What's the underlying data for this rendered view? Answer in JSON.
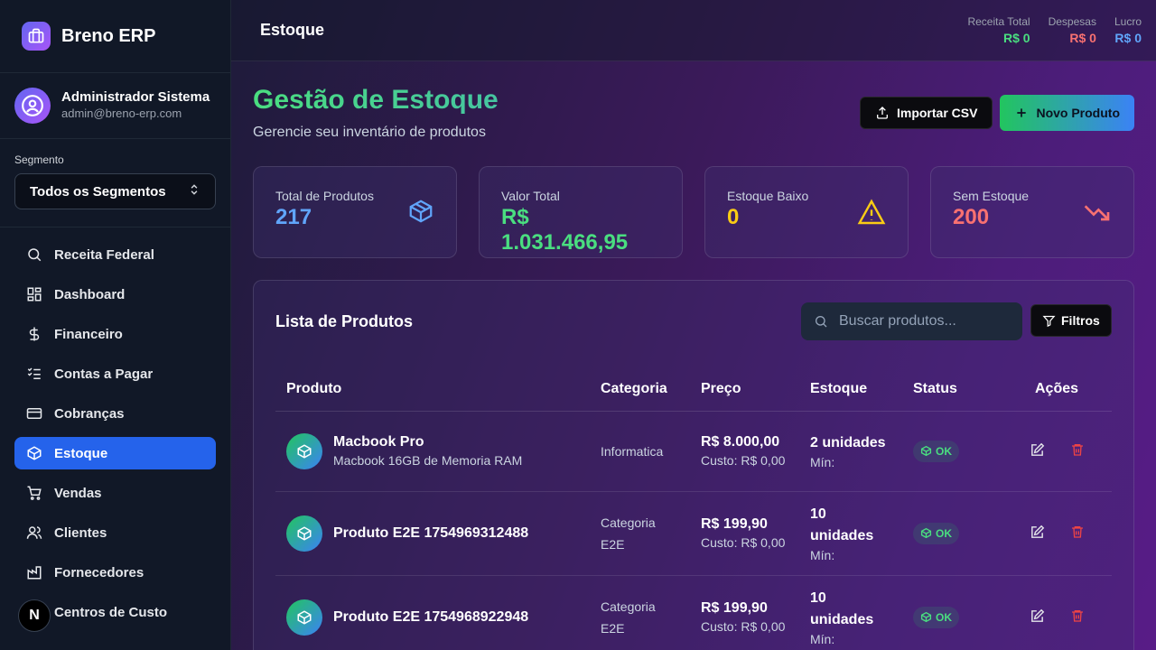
{
  "app": {
    "name": "Breno ERP"
  },
  "user": {
    "name": "Administrador Sistema",
    "email": "admin@breno-erp.com"
  },
  "segment": {
    "label": "Segmento",
    "selected": "Todos os Segmentos"
  },
  "nav": [
    {
      "label": "Receita Federal",
      "icon": "search-icon"
    },
    {
      "label": "Dashboard",
      "icon": "dashboard-icon"
    },
    {
      "label": "Financeiro",
      "icon": "dollar-icon"
    },
    {
      "label": "Contas a Pagar",
      "icon": "checklist-icon"
    },
    {
      "label": "Cobranças",
      "icon": "credit-card-icon"
    },
    {
      "label": "Estoque",
      "icon": "package-icon",
      "active": true
    },
    {
      "label": "Vendas",
      "icon": "cart-icon"
    },
    {
      "label": "Clientes",
      "icon": "users-icon"
    },
    {
      "label": "Fornecedores",
      "icon": "factory-icon"
    },
    {
      "label": "Centros de Custo",
      "icon": "next-icon"
    }
  ],
  "next_badge": "N",
  "topbar": {
    "title": "Estoque",
    "kpis": [
      {
        "label": "Receita Total",
        "value": "R$ 0",
        "color": "#4ade80"
      },
      {
        "label": "Despesas",
        "value": "R$ 0",
        "color": "#f87171"
      },
      {
        "label": "Lucro",
        "value": "R$ 0",
        "color": "#60a5fa"
      }
    ]
  },
  "page": {
    "title": "Gestão de Estoque",
    "subtitle": "Gerencie seu inventário de produtos",
    "import_label": "Importar CSV",
    "new_label": "Novo Produto"
  },
  "stats": [
    {
      "label": "Total de Produtos",
      "value": "217",
      "color": "#60a5fa",
      "icon": "package-icon"
    },
    {
      "label": "Valor Total",
      "value": "R$ 1.031.466,95",
      "color": "#4ade80",
      "icon": ""
    },
    {
      "label": "Estoque Baixo",
      "value": "0",
      "color": "#facc15",
      "icon": "warning-icon"
    },
    {
      "label": "Sem Estoque",
      "value": "200",
      "color": "#f87171",
      "icon": "trending-down-icon"
    }
  ],
  "products": {
    "title": "Lista de Produtos",
    "search_placeholder": "Buscar produtos...",
    "filter_label": "Filtros",
    "columns": [
      "Produto",
      "Categoria",
      "Preço",
      "Estoque",
      "Status",
      "Ações"
    ],
    "rows": [
      {
        "name": "Macbook Pro",
        "desc": "Macbook 16GB de Memoria RAM",
        "category": "Informatica",
        "price": "R$ 8.000,00",
        "cost": "Custo: R$ 0,00",
        "stock": "2 unidades",
        "min": "Mín:",
        "status": "OK"
      },
      {
        "name": "Produto E2E 1754969312488",
        "desc": "",
        "category": "Categoria E2E",
        "price": "R$ 199,90",
        "cost": "Custo: R$ 0,00",
        "stock": "10 unidades",
        "min": "Mín:",
        "status": "OK"
      },
      {
        "name": "Produto E2E 1754968922948",
        "desc": "",
        "category": "Categoria E2E",
        "price": "R$ 199,90",
        "cost": "Custo: R$ 0,00",
        "stock": "10 unidades",
        "min": "Mín:",
        "status": "OK"
      }
    ]
  }
}
